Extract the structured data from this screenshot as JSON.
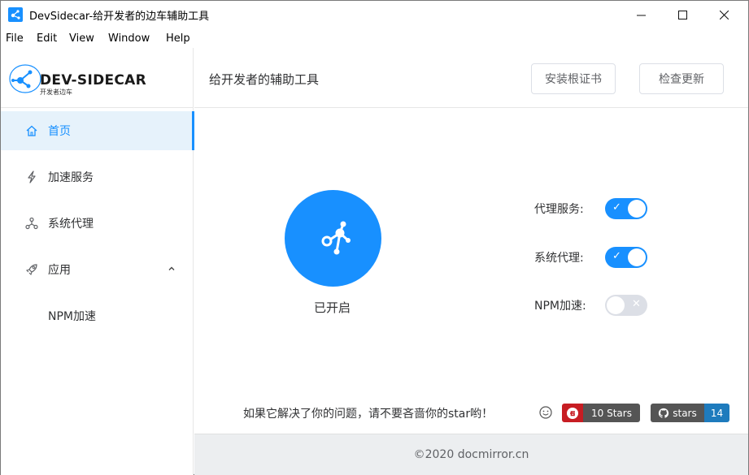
{
  "window": {
    "title": "DevSidecar-给开发者的边车辅助工具",
    "minimize": "—",
    "maximize": "☐",
    "close": "✕"
  },
  "menu": {
    "items": [
      "File",
      "Edit",
      "View",
      "Window",
      "Help"
    ]
  },
  "sidebar": {
    "logo_title": "DEV-SIDECAR",
    "logo_subtitle": "开发者边车",
    "items": [
      {
        "label": "首页",
        "icon": "home-icon",
        "active": true
      },
      {
        "label": "加速服务",
        "icon": "lightning-icon",
        "active": false
      },
      {
        "label": "系统代理",
        "icon": "network-icon",
        "active": false
      },
      {
        "label": "应用",
        "icon": "rocket-icon",
        "active": false,
        "expanded": true
      },
      {
        "label": "NPM加速",
        "icon": "",
        "active": false
      }
    ]
  },
  "header": {
    "title": "给开发者的辅助工具",
    "install_cert_label": "安装根证书",
    "check_update_label": "检查更新"
  },
  "main": {
    "status_label": "已开启",
    "switches": [
      {
        "label": "代理服务:",
        "on": true
      },
      {
        "label": "系统代理:",
        "on": true
      },
      {
        "label": "NPM加速:",
        "on": false
      }
    ],
    "star_text": "如果它解决了你的问题，请不要吝啬你的star哟！",
    "gitee_badge": "10 Stars",
    "github_badge_label": "stars",
    "github_badge_count": "14"
  },
  "footer": {
    "text": "©2020 docmirror.cn"
  },
  "colors": {
    "accent": "#1890ff",
    "active_bg": "#e6f2fb",
    "gitee_red": "#c71d23",
    "github_blue": "#1e7bbd",
    "footer_bg": "#eceef0"
  }
}
